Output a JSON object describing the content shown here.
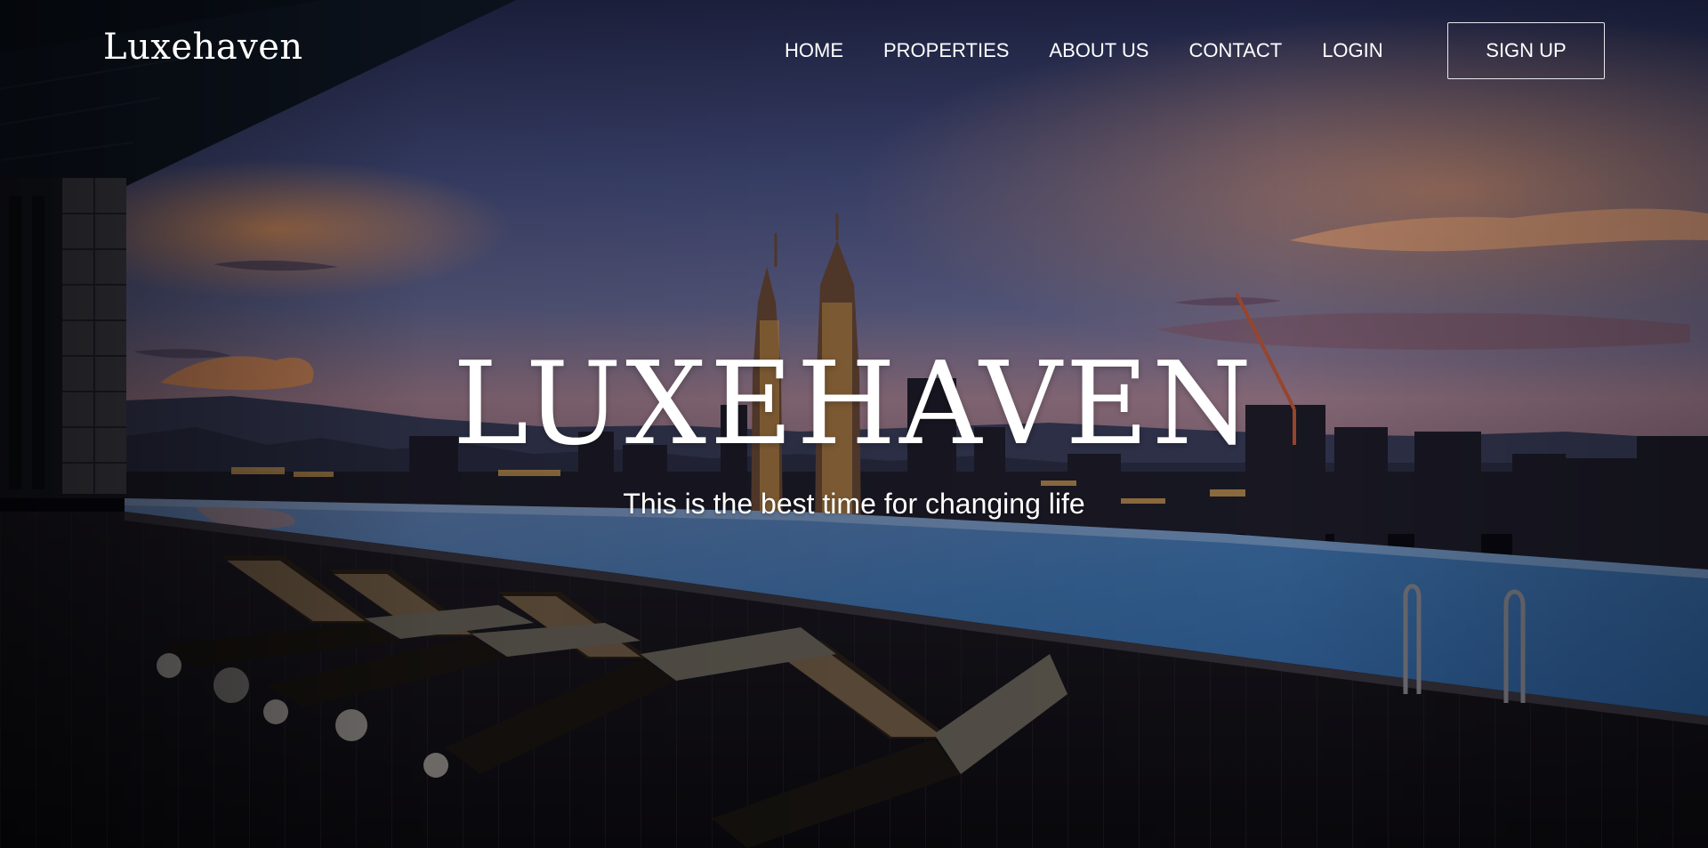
{
  "brand": {
    "logo_text": "Luxehaven"
  },
  "nav": {
    "items": [
      {
        "label": "HOME"
      },
      {
        "label": "PROPERTIES"
      },
      {
        "label": "ABOUT US"
      },
      {
        "label": "CONTACT"
      },
      {
        "label": "LOGIN"
      }
    ],
    "cta_label": "SIGN UP"
  },
  "hero": {
    "title": "LUXEHAVEN",
    "subtitle": "This is the best time for changing life",
    "background_image": "rooftop-infinity-pool-city-skyline-at-dusk-photo"
  },
  "colors": {
    "text": "#ffffff",
    "sky_top": "#2c3461",
    "sky_mid": "#5a6396",
    "sunset_glow": "#d98a62",
    "pool": "#3f78b8",
    "deck": "#18161e"
  }
}
